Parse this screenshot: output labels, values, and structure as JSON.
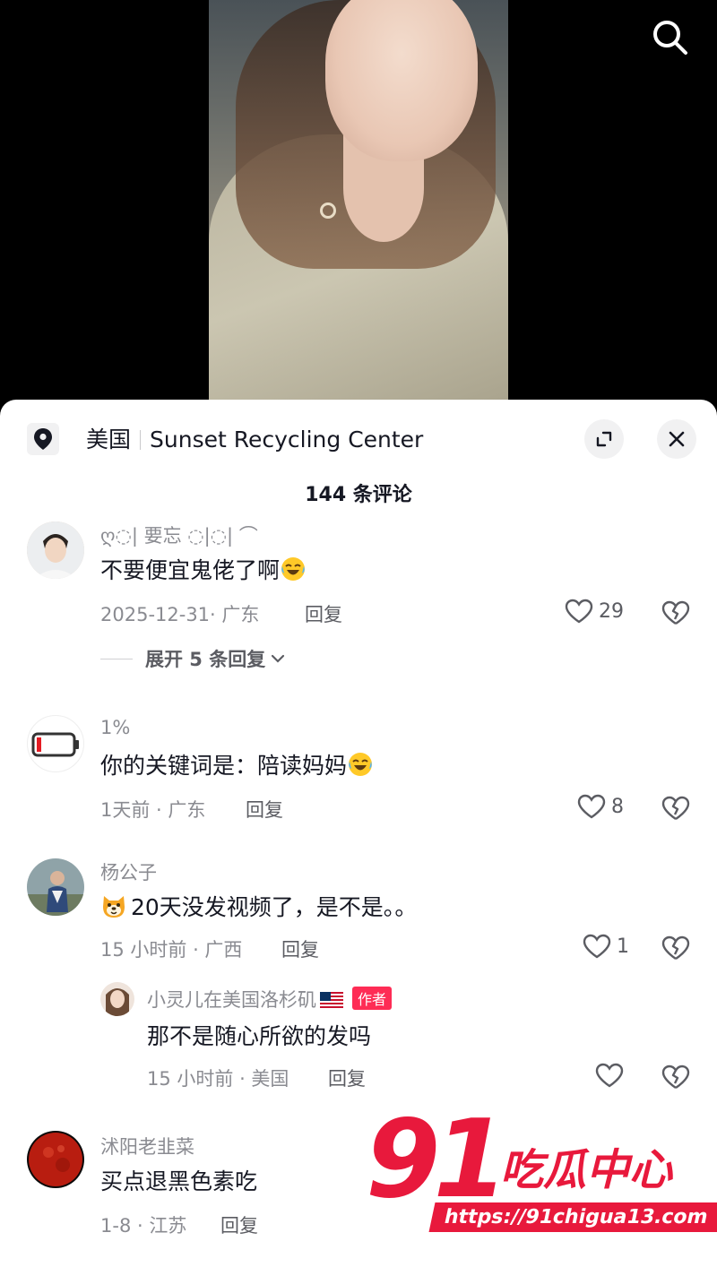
{
  "location": {
    "country": "美国",
    "place": "Sunset Recycling Center"
  },
  "sheet_title": "144 条评论",
  "comments": [
    {
      "user": "ღ◌| 要忘 ◌|◌| ⌒",
      "text": "不要便宜鬼佬了啊",
      "emoji": "laughing-crying-emoji",
      "meta": "2025-12-31· 广东",
      "reply_label": "回复",
      "likes": "29",
      "expand_label": "展开 5 条回复"
    },
    {
      "user": "1%",
      "text": "你的关键词是：陪读妈妈",
      "emoji": "laughing-crying-emoji",
      "meta": "1天前 · 广东",
      "reply_label": "回复",
      "likes": "8"
    },
    {
      "user": "杨公子",
      "text": "20天没发视频了，是不是。。",
      "emoji": "dog-face-emoji",
      "meta": "15 小时前 · 广西",
      "reply_label": "回复",
      "likes": "1",
      "reply": {
        "user": "小灵儿在美国洛杉矶",
        "flag": "us-flag",
        "author_tag": "作者",
        "text": "那不是随心所欲的发吗",
        "meta": "15 小时前 · 美国",
        "reply_label": "回复",
        "likes": ""
      }
    },
    {
      "user": "沭阳老韭菜",
      "text": "买点退黑色素吃",
      "meta": "1-8 · 江苏",
      "reply_label": "回复"
    }
  ],
  "watermark": {
    "number": "91",
    "name": "吃瓜中心",
    "url": "https://91chigua13.com"
  },
  "colors": {
    "accent": "#fe2c55",
    "watermark": "#e8193c",
    "secondary_text": "#8a8b91"
  }
}
